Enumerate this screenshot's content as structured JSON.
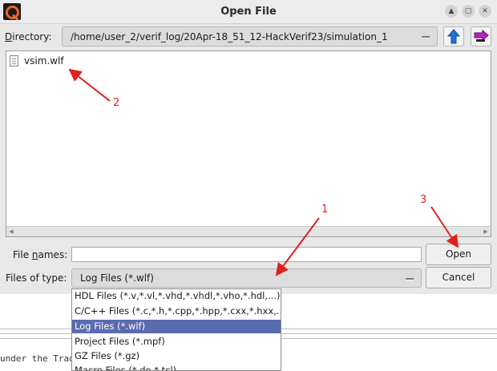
{
  "window": {
    "title": "Open File",
    "controls": [
      "up-icon",
      "maximize-icon",
      "close-icon"
    ]
  },
  "directory": {
    "label": "Directory:",
    "path": "/home/user_2/verif_log/20Apr-18_51_12-HackVerif23/simulation_1"
  },
  "files": [
    {
      "name": "vsim.wlf",
      "icon": "document-icon"
    }
  ],
  "file_names": {
    "label": "File names:",
    "value": ""
  },
  "files_of_type": {
    "label": "Files of type:",
    "selected": "Log Files (*.wlf)",
    "options": [
      "HDL Files (*.v,*.vl,*.vhd,*.vhdl,*.vho,*.hdl,...)",
      "C/C++ Files (*.c,*.h,*.cpp,*.hpp,*.cxx,*.hxx,...)",
      "Log Files (*.wlf)",
      "Project Files (*.mpf)",
      "GZ Files (*.gz)",
      "Macro Files (*.do,*.tcl)"
    ]
  },
  "buttons": {
    "open": "Open",
    "cancel": "Cancel"
  },
  "background_text": "under the Trade",
  "annotations": [
    "1",
    "2",
    "3"
  ],
  "colors": {
    "selection": "#5b6bb0",
    "annotation": "#e02020",
    "up_arrow": "#1f72d6"
  }
}
